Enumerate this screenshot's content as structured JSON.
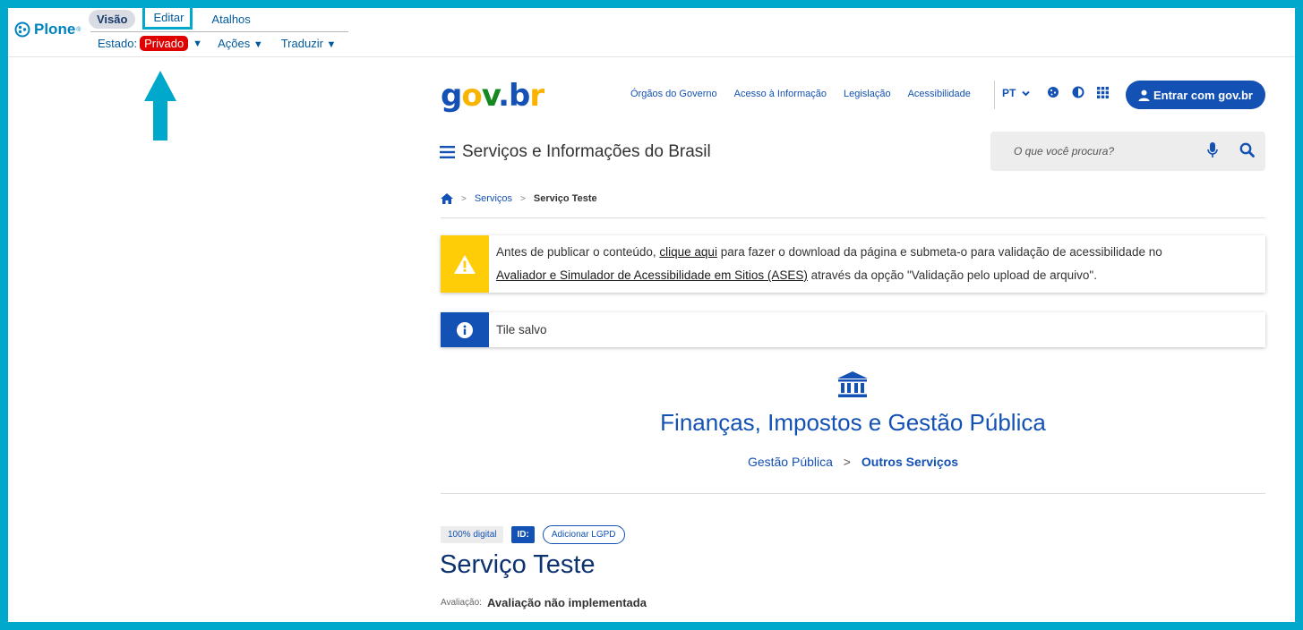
{
  "plone_toolbar": {
    "logo": "Plone",
    "tabs": [
      {
        "label": "Visão"
      },
      {
        "label": "Editar"
      },
      {
        "label": "Atalhos"
      }
    ],
    "estado_label": "Estado:",
    "estado_value": "Privado",
    "acoes_label": "Ações",
    "traduzir_label": "Traduzir",
    "dropdown_glyph": "▼"
  },
  "header": {
    "logo": {
      "g": "g",
      "o": "o",
      "v": "v",
      "dot": ".",
      "b": "b",
      "r": "r"
    },
    "links": [
      "Órgãos do Governo",
      "Acesso à Informação",
      "Legislação",
      "Acessibilidade"
    ],
    "language": "PT",
    "login_label": "Entrar com gov.br",
    "site_title": "Serviços e Informações do Brasil",
    "search_placeholder": "O que você procura?"
  },
  "breadcrumb": {
    "items": [
      {
        "label": "Serviços"
      },
      {
        "label": "Serviço Teste"
      }
    ],
    "separator": ">"
  },
  "alerts": {
    "warning": {
      "line1_pre": "Antes de publicar o conteúdo, ",
      "line1_link": "clique aqui",
      "line1_post": " para fazer o download da página e submeta-o para validação de acessibilidade no",
      "line2_link": "Avaliador e Simulador de Acessibilidade em Sitios (ASES)",
      "line2_post": " através da opção \"Validação pelo upload de arquivo\"."
    },
    "info": {
      "text": "Tile salvo"
    }
  },
  "hero": {
    "title": "Finanças, Impostos e Gestão Pública",
    "crumb_parent": "Gestão Pública",
    "crumb_sep": ">",
    "crumb_current": "Outros Serviços"
  },
  "service": {
    "tags": {
      "digital": "100% digital",
      "id": "ID:",
      "lgpd": "Adicionar LGPD"
    },
    "title": "Serviço Teste",
    "rating_label": "Avaliação:",
    "rating_value": "Avaliação não implementada"
  },
  "colors": {
    "frame": "#00a8cc",
    "primary": "#1351b4",
    "dark_blue": "#0c326f",
    "warning": "#ffcd07",
    "private_badge": "#e00000"
  }
}
